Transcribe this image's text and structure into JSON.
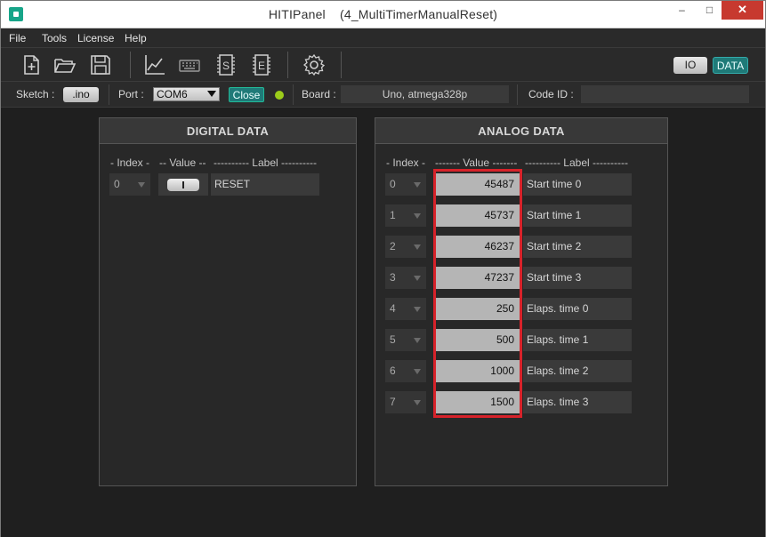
{
  "window": {
    "title_app": "HITIPanel",
    "title_sketch": "(4_MultiTimerManualReset)",
    "minimize_glyph": "–",
    "maximize_glyph": "□",
    "close_glyph": "✕"
  },
  "menu": {
    "items": [
      "File",
      "Tools",
      "License",
      "Help"
    ]
  },
  "toolbar": {
    "icons": [
      "new-file-icon",
      "open-folder-icon",
      "save-icon",
      "chart-icon",
      "keyboard-icon",
      "sketch-s-icon",
      "sketch-e-icon",
      "gear-icon"
    ],
    "io_label": "IO",
    "data_label": "DATA"
  },
  "status": {
    "sketch_label": "Sketch :",
    "sketch_button": ".ino",
    "port_label": "Port :",
    "port_value": "COM6",
    "close_button": "Close",
    "board_label": "Board :",
    "board_value": "Uno, atmega328p",
    "code_label": "Code ID :",
    "code_value": "",
    "led_color": "#9ccc1a"
  },
  "digital": {
    "title": "DIGITAL  DATA",
    "col_index": "- Index -",
    "col_value": "-- Value --",
    "col_label": "---------- Label ----------",
    "rows": [
      {
        "index": "0",
        "label": "RESET"
      }
    ]
  },
  "analog": {
    "title": "ANALOG  DATA",
    "col_index": "- Index -",
    "col_value": "------- Value -------",
    "col_label": "---------- Label ----------",
    "rows": [
      {
        "index": "0",
        "value": "45487",
        "label": "Start time 0"
      },
      {
        "index": "1",
        "value": "45737",
        "label": "Start time 1"
      },
      {
        "index": "2",
        "value": "46237",
        "label": "Start time 2"
      },
      {
        "index": "3",
        "value": "47237",
        "label": "Start time 3"
      },
      {
        "index": "4",
        "value": "250",
        "label": "Elaps. time 0"
      },
      {
        "index": "5",
        "value": "500",
        "label": "Elaps. time 1"
      },
      {
        "index": "6",
        "value": "1000",
        "label": "Elaps. time 2"
      },
      {
        "index": "7",
        "value": "1500",
        "label": "Elaps. time 3"
      }
    ]
  },
  "colors": {
    "accent_teal": "#1f7a78",
    "highlight_red": "#d7222a"
  }
}
